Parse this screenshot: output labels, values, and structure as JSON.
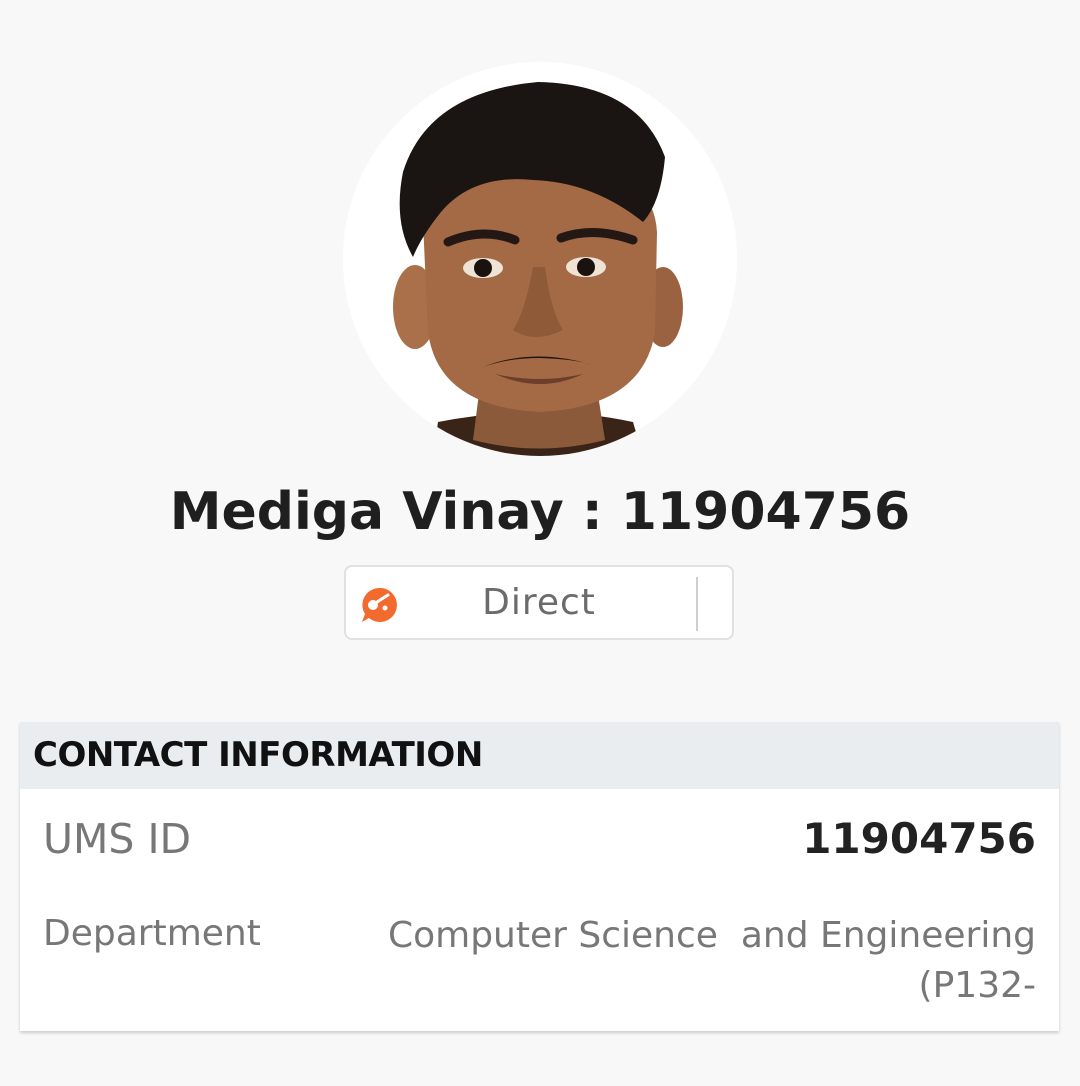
{
  "profile": {
    "name": "Mediga Vinay : 11904756",
    "avatar": "profile-photo"
  },
  "direct_button": {
    "label": "Direct",
    "icon": "chat-bubble-icon",
    "icon_color": "#f26a2e"
  },
  "contact_info": {
    "title": "CONTACT INFORMATION",
    "rows": [
      {
        "label": "UMS ID",
        "value": "11904756"
      },
      {
        "label": "Department",
        "value": "Computer Science  and Engineering\n(P132-"
      }
    ]
  },
  "colors": {
    "background": "#f8f8f8",
    "header_background": "#eaedf0",
    "card_background": "#ffffff"
  }
}
